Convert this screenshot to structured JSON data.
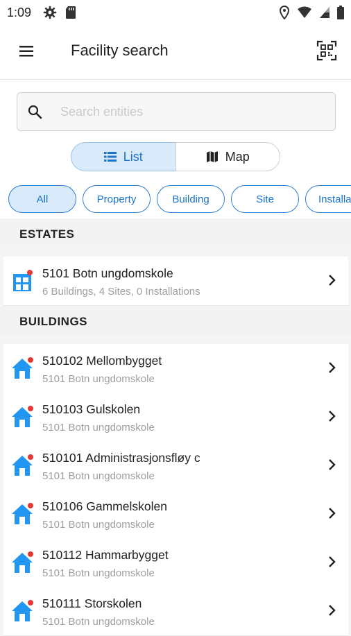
{
  "status_bar": {
    "time": "1:09",
    "left_icons": [
      "gear-icon",
      "sd-card-icon"
    ],
    "right_icons": [
      "location-icon",
      "wifi-icon",
      "signal-icon",
      "battery-icon"
    ]
  },
  "app_bar": {
    "title": "Facility search",
    "menu_icon": "hamburger-menu-icon",
    "action_icon": "qr-scan-icon"
  },
  "search": {
    "placeholder": "Search entities",
    "value": ""
  },
  "view_toggle": {
    "list_label": "List",
    "map_label": "Map",
    "selected": "List"
  },
  "filters": [
    {
      "label": "All",
      "active": true
    },
    {
      "label": "Property",
      "active": false
    },
    {
      "label": "Building",
      "active": false
    },
    {
      "label": "Site",
      "active": false
    },
    {
      "label": "Installa",
      "active": false
    }
  ],
  "estates": {
    "header": "ESTATES",
    "items": [
      {
        "title": "5101 Botn ungdomskole",
        "subtitle": "6 Buildings, 4 Sites, 0 Installations"
      }
    ]
  },
  "buildings": {
    "header": "BUILDINGS",
    "items": [
      {
        "title": "510102 Mellombygget",
        "subtitle": "5101 Botn ungdomskole"
      },
      {
        "title": "510103 Gulskolen",
        "subtitle": "5101 Botn ungdomskole"
      },
      {
        "title": "510101 Administrasjonsfløy c",
        "subtitle": "5101 Botn ungdomskole"
      },
      {
        "title": "510106 Gammelskolen",
        "subtitle": "5101 Botn ungdomskole"
      },
      {
        "title": "510112 Hammarbygget",
        "subtitle": "5101 Botn ungdomskole"
      },
      {
        "title": "510111 Storskolen",
        "subtitle": "5101 Botn ungdomskole"
      }
    ]
  },
  "colors": {
    "accent": "#1a73c9",
    "icon_blue": "#2196f3",
    "badge_red": "#e53935",
    "selected_bg": "#d9ebfb"
  }
}
